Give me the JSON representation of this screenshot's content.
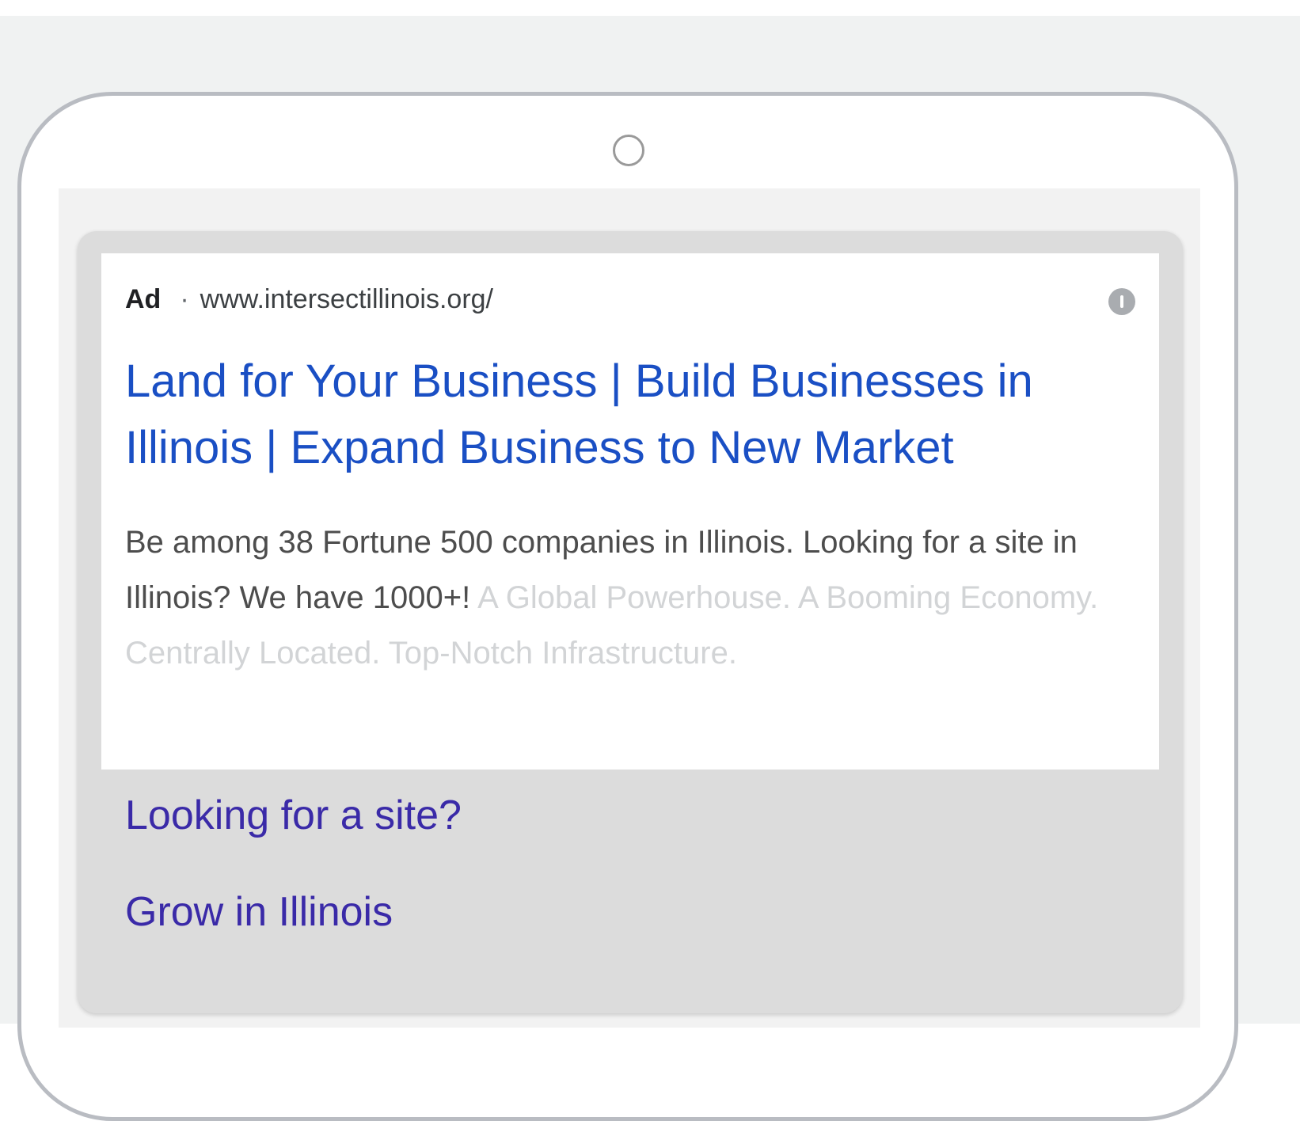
{
  "ad": {
    "label": "Ad",
    "separator": "·",
    "display_url": "www.intersectillinois.org/",
    "headline_line1": "Land for Your Business | Build Businesses in",
    "headline_line2": "Illinois | Expand Business to New Market",
    "description_visible": "Be among 38 Fortune 500 companies in Illinois. Looking for a site in Illinois? We have 1000+!",
    "description_faded": "A Global Powerhouse. A Booming Economy. Centrally Located. Top-Notch Infrastructure.",
    "sitelinks": [
      {
        "label": "Looking for a site?"
      },
      {
        "label": "Grow in Illinois"
      }
    ]
  },
  "colors": {
    "headline": "#1a4fc4",
    "sitelink": "#3a2aa8",
    "description": "#4d4d4d",
    "description_faded": "#d2d4d6",
    "card_background": "#dcdcdc",
    "device_frame": "#b9bcc2"
  },
  "icons": {
    "info": "info-icon",
    "camera": "camera-icon"
  }
}
